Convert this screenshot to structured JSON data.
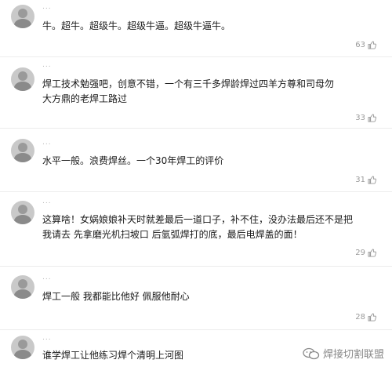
{
  "comments": [
    {
      "username": "...",
      "text": "牛。超牛。超级牛。超级牛逼。超级牛逼牛。",
      "likes": "63"
    },
    {
      "username": "...",
      "text": "焊工技术勉强吧，创意不错，一个有三千多焊龄焊过四羊方尊和司母勿大方鼎的老焊工路过",
      "likes": "33"
    },
    {
      "username": "...",
      "text": "水平一般。浪费焊丝。一个30年焊工的评价",
      "likes": "31"
    },
    {
      "username": "...",
      "text": "这算啥！女娲娘娘补天时就差最后一道口子，补不住，没办法最后还不是把我请去 先拿磨光机扫坡口 后氩弧焊打的底，最后电焊盖的面！",
      "likes": "29"
    },
    {
      "username": "...",
      "text": "焊工一般 我都能比他好 佩服他耐心",
      "likes": "28"
    },
    {
      "username": "...",
      "text": "谁学焊工让他练习焊个清明上河图",
      "likes": ""
    }
  ],
  "watermark": {
    "text": "焊接切割联盟"
  },
  "colors": {
    "text": "#1a1a1a",
    "meta": "#9a9a9a",
    "divider": "#ececec"
  },
  "icons": {
    "like": "thumb-up-icon",
    "watermark": "wechat-icon"
  }
}
